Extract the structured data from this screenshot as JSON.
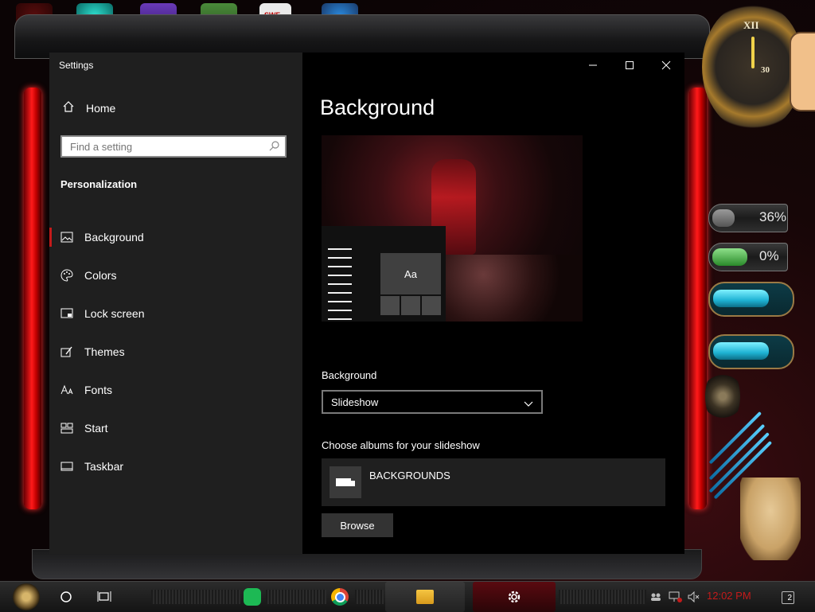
{
  "window": {
    "title": "Settings",
    "controls": [
      "minimize",
      "maximize",
      "close"
    ]
  },
  "sidebar": {
    "home_label": "Home",
    "search_placeholder": "Find a setting",
    "section_title": "Personalization",
    "items": [
      {
        "label": "Background",
        "icon": "image-icon",
        "selected": true
      },
      {
        "label": "Colors",
        "icon": "palette-icon",
        "selected": false
      },
      {
        "label": "Lock screen",
        "icon": "lock-screen-icon",
        "selected": false
      },
      {
        "label": "Themes",
        "icon": "themes-icon",
        "selected": false
      },
      {
        "label": "Fonts",
        "icon": "fonts-icon",
        "selected": false
      },
      {
        "label": "Start",
        "icon": "start-icon",
        "selected": false
      },
      {
        "label": "Taskbar",
        "icon": "taskbar-icon",
        "selected": false
      }
    ]
  },
  "main": {
    "page_title": "Background",
    "preview_tile_text": "Aa",
    "background_label": "Background",
    "background_value": "Slideshow",
    "albums_label": "Choose albums for your slideshow",
    "album_name": "BACKGROUNDS",
    "browse_label": "Browse"
  },
  "desktop": {
    "gauge_1": "36%",
    "gauge_2": "0%",
    "clock_numbers": {
      "xii": "XII",
      "thirty": "30"
    },
    "desktop_icon_label": "SWF"
  },
  "taskbar": {
    "time": "12:02 PM",
    "notification_count": "2"
  },
  "colors": {
    "accent_red": "#c41a1a",
    "window_bg": "#000000",
    "sidebar_bg": "#1f1f1f"
  }
}
